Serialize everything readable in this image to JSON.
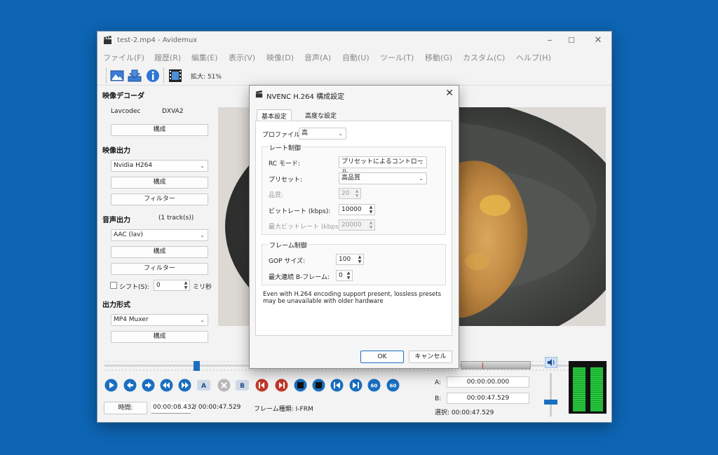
{
  "window": {
    "title": "test-2.mp4 - Avidemux",
    "minimize": "–",
    "maximize": "☐",
    "close": "✕"
  },
  "menu": [
    "ファイル(F)",
    "履歴(R)",
    "編集(E)",
    "表示(V)",
    "映像(D)",
    "音声(A)",
    "自動(U)",
    "ツール(T)",
    "移動(G)",
    "カスタム(C)",
    "ヘルプ(H)"
  ],
  "toolbar": {
    "zoom_label": "拡大: 51%"
  },
  "sidebar": {
    "video_decoder": {
      "title": "映像デコーダ",
      "decoder": "Lavcodec",
      "hw": "DXVA2",
      "config": "構成"
    },
    "video_output": {
      "title": "映像出力",
      "codec": "Nvidia H264",
      "config": "構成",
      "filters": "フィルター"
    },
    "audio_output": {
      "title": "音声出力",
      "tracks": "(1 track(s))",
      "codec": "AAC (lav)",
      "config": "構成",
      "filters": "フィルター",
      "shift_label": "シフト(S):",
      "shift_value": "0",
      "shift_unit": "ミリ秒"
    },
    "output_format": {
      "title": "出力形式",
      "muxer": "MP4 Muxer",
      "config": "構成"
    }
  },
  "status": {
    "time_button": "時間:",
    "current_time": "00:00:08.432",
    "total_time": "/ 00:00:47.529",
    "frame_type": "フレーム種類: I-FRM",
    "a_label": "A:",
    "a_value": "00:00:00.000",
    "b_label": "B:",
    "b_value": "00:00:47.529",
    "selection": "選択: 00:00:47.529"
  },
  "playhead_fraction": 0.18,
  "dialog": {
    "title": "NVENC H.264 構成設定",
    "close": "✕",
    "tabs": [
      "基本設定",
      "高度な設定"
    ],
    "profile_label": "プロファイル:",
    "profile_value": "高",
    "rate_group": "レート制御",
    "rc_label": "RC モード:",
    "rc_value": "プリセットによるコントロール",
    "preset_label": "プリセット:",
    "preset_value": "高品質",
    "quality_label": "品質:",
    "quality_value": "20",
    "bitrate_label": "ビットレート (kbps):",
    "bitrate_value": "10000",
    "maxbitrate_label": "最大ビットレート (kbps):",
    "maxbitrate_value": "20000",
    "frame_group": "フレーム制御",
    "gop_label": "GOP サイズ:",
    "gop_value": "100",
    "bframes_label": "最大連続 B-フレーム:",
    "bframes_value": "0",
    "note": "Even with H.264 encoding support present, lossless presets may be unavailable with older hardware",
    "ok": "OK",
    "cancel": "キャンセル"
  },
  "colors": {
    "background": "#0d65b4",
    "accent": "#1a6fc0",
    "meter_green": "#27c93f"
  }
}
